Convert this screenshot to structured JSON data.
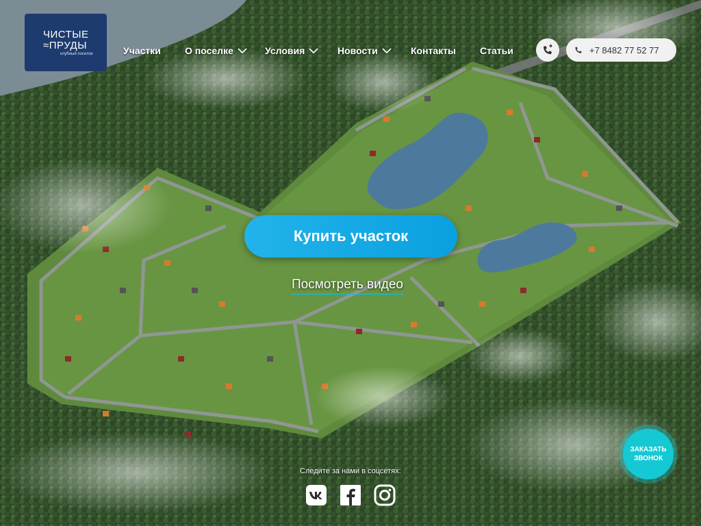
{
  "logo": {
    "line1": "ЧИСТЫЕ",
    "line2": "≈ПРУДЫ",
    "tagline": "клубный поселок"
  },
  "nav": [
    {
      "label": "Участки",
      "has_menu": false
    },
    {
      "label": "О поселке",
      "has_menu": true
    },
    {
      "label": "Условия",
      "has_menu": true
    },
    {
      "label": "Новости",
      "has_menu": true
    },
    {
      "label": "Контакты",
      "has_menu": false
    },
    {
      "label": "Статьи",
      "has_menu": false
    }
  ],
  "phone": {
    "number": "+7 8482 77 52 77"
  },
  "hero": {
    "buy_button": "Купить участок",
    "video_link": "Посмотреть видео"
  },
  "social": {
    "title": "Следите за нами в соцсетях:",
    "icons": [
      "vk-icon",
      "facebook-icon",
      "instagram-icon"
    ]
  },
  "callback": {
    "line1": "ЗАКАЗАТЬ",
    "line2": "ЗВОНОК"
  },
  "colors": {
    "logo_bg": "#1d3b6e",
    "accent_blue": "#15aee8",
    "callback": "#14c9d4"
  }
}
